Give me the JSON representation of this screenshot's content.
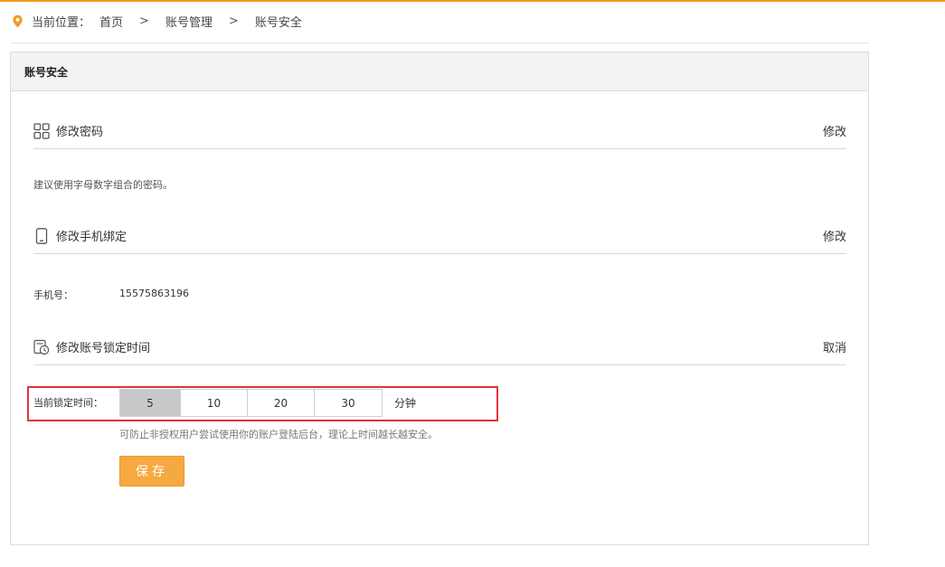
{
  "breadcrumb": {
    "label": "当前位置：",
    "items": [
      "首页",
      "账号管理",
      "账号安全"
    ],
    "separator": ">"
  },
  "panel": {
    "title": "账号安全"
  },
  "sections": {
    "password": {
      "title": "修改密码",
      "action": "修改",
      "description": "建议使用字母数字组合的密码。"
    },
    "phone": {
      "title": "修改手机绑定",
      "action": "修改",
      "phone_label": "手机号：",
      "phone_value": "15575863196"
    },
    "lock": {
      "title": "修改账号锁定时间",
      "action": "取消",
      "current_label": "当前锁定时间：",
      "options": [
        "5",
        "10",
        "20",
        "30"
      ],
      "selected": "5",
      "unit": "分钟",
      "hint": "可防止非授权用户尝试使用你的账户登陆后台，理论上时间越长越安全。",
      "save_label": "保存"
    }
  },
  "colors": {
    "accent": "#f39a1e",
    "save_button": "#f5a941",
    "highlight_box": "#e0333a",
    "selected_option": "#c9c9c9"
  }
}
